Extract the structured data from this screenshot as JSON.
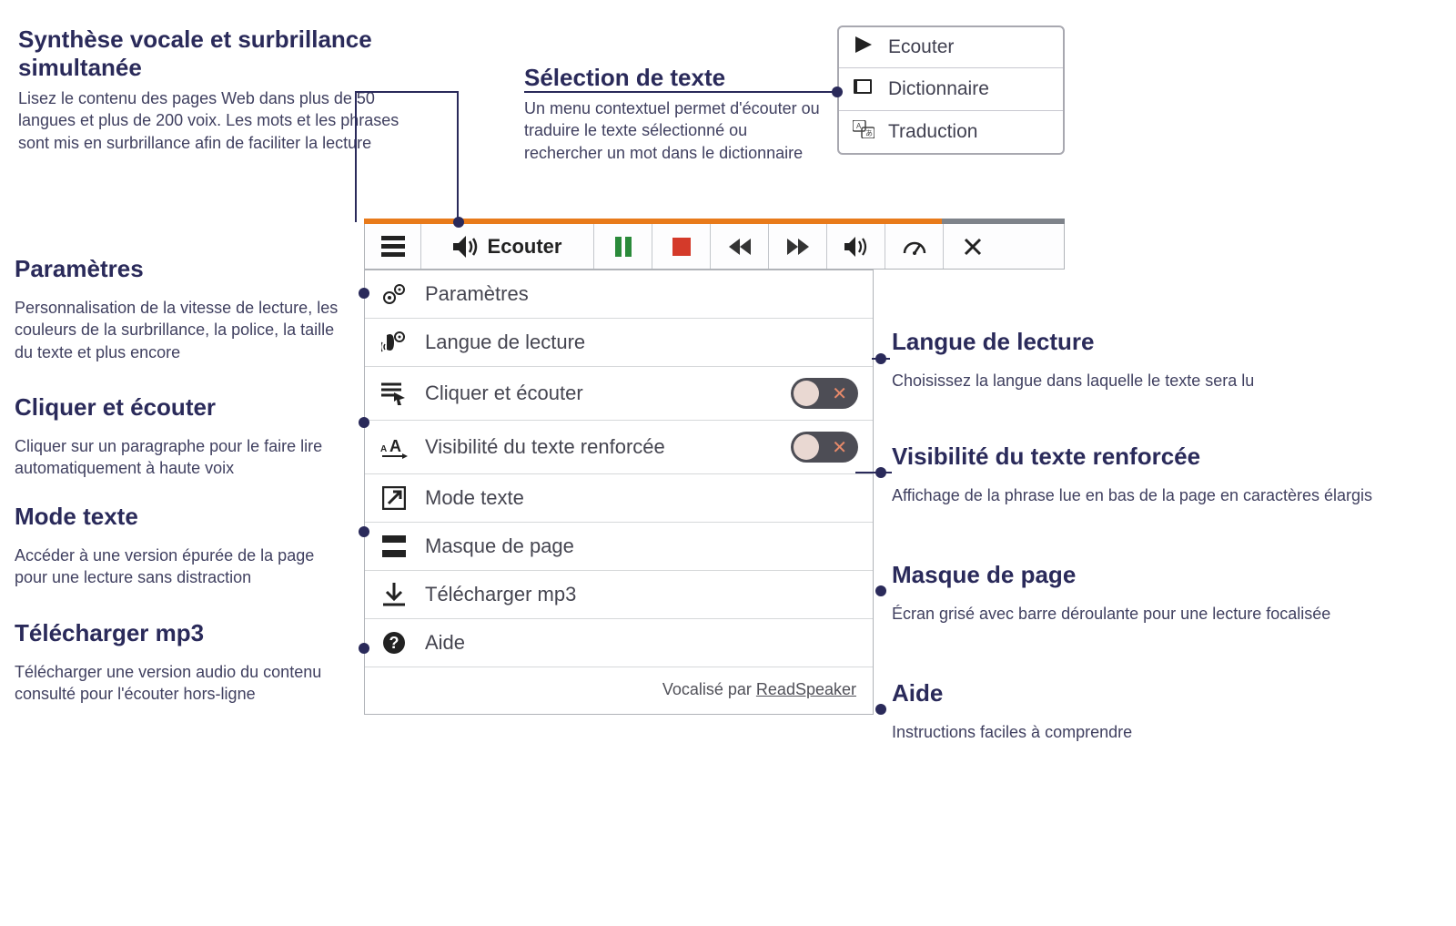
{
  "annotations": {
    "tts": {
      "title": "Synthèse vocale et surbrillance simultanée",
      "desc": "Lisez le contenu des pages Web dans plus de 50 langues et plus de 200 voix. Les mots et les phrases sont mis en surbrillance afin de faciliter la lecture"
    },
    "select": {
      "title": "Sélection de texte",
      "desc": "Un menu contextuel permet d'écouter ou traduire le texte sélectionné ou rechercher un mot dans le dictionnaire"
    },
    "params": {
      "title": "Paramètres",
      "desc": "Personnalisation de la vitesse de lecture, les couleurs de la surbrillance, la police, la taille du texte et plus encore"
    },
    "click": {
      "title": "Cliquer et écouter",
      "desc": "Cliquer sur un paragraphe pour le faire lire automatiquement à haute voix"
    },
    "text": {
      "title": "Mode texte",
      "desc": "Accéder à une version épurée de la page pour une lecture sans distraction"
    },
    "mp3": {
      "title": "Télécharger mp3",
      "desc": "Télécharger une version audio du contenu consulté pour l'écouter hors-ligne"
    },
    "lang": {
      "title": "Langue de lecture",
      "desc": "Choisissez la langue dans laquelle le texte sera lu"
    },
    "vis": {
      "title": "Visibilité du texte renforcée",
      "desc": "Affichage de la phrase lue en bas de la page en caractères élargis"
    },
    "mask": {
      "title": "Masque de page",
      "desc": "Écran grisé avec barre déroulante pour une lecture focalisée"
    },
    "help": {
      "title": "Aide",
      "desc": "Instructions faciles à comprendre"
    }
  },
  "context_menu": {
    "listen": "Ecouter",
    "dict": "Dictionnaire",
    "trans": "Traduction"
  },
  "toolbar": {
    "listen": "Ecouter"
  },
  "dropdown": {
    "items": {
      "params": "Paramètres",
      "lang": "Langue de lecture",
      "click": "Cliquer et écouter",
      "vis": "Visibilité du texte renforcée",
      "text": "Mode texte",
      "mask": "Masque de page",
      "mp3": "Télécharger mp3",
      "help": "Aide"
    },
    "footer_prefix": "Vocalisé par ",
    "footer_brand": "ReadSpeaker"
  }
}
